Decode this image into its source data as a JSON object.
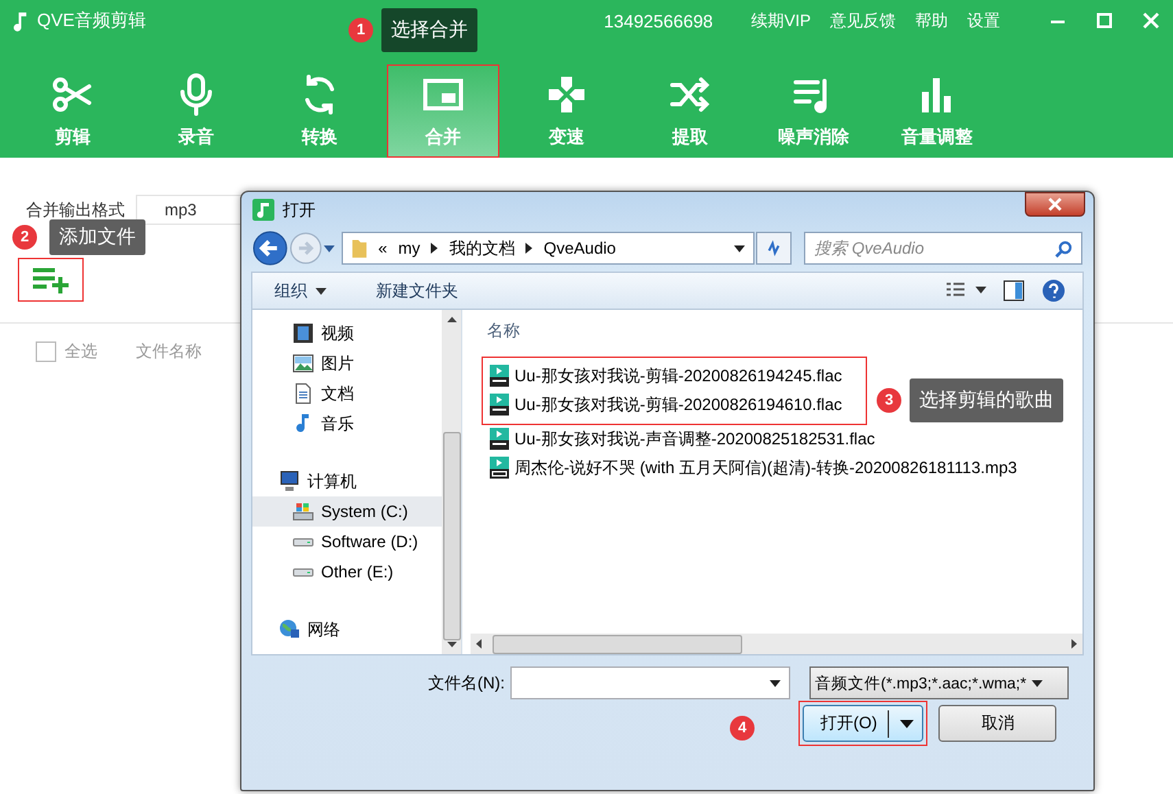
{
  "app": {
    "title": "QVE音频剪辑",
    "phone": "13492566698",
    "links": [
      "续期VIP",
      "意见反馈",
      "帮助",
      "设置"
    ]
  },
  "tools": [
    {
      "label": "剪辑",
      "selected": false,
      "highlighted": false
    },
    {
      "label": "录音",
      "selected": false,
      "highlighted": false
    },
    {
      "label": "转换",
      "selected": false,
      "highlighted": false
    },
    {
      "label": "合并",
      "selected": true,
      "highlighted": true
    },
    {
      "label": "变速",
      "selected": false,
      "highlighted": false
    },
    {
      "label": "提取",
      "selected": false,
      "highlighted": false
    },
    {
      "label": "噪声消除",
      "selected": false,
      "highlighted": false
    },
    {
      "label": "音量调整",
      "selected": false,
      "highlighted": false
    }
  ],
  "merge": {
    "format_label": "合并输出格式",
    "format_value": "mp3",
    "add_highlighted": true,
    "select_all": {
      "label": "全选",
      "checked": false
    },
    "column_2": "文件名称"
  },
  "callouts": [
    {
      "number": "1",
      "text": "选择合并"
    },
    {
      "number": "2",
      "text": "添加文件"
    },
    {
      "number": "3",
      "text": "选择剪辑的歌曲"
    },
    {
      "number": "4"
    }
  ],
  "dialog": {
    "title": "打开",
    "path": [
      "«",
      "my",
      "我的文档",
      "QveAudio"
    ],
    "search_placeholder": "搜索 QveAudio",
    "organize": "组织",
    "new_folder": "新建文件夹",
    "nav": [
      {
        "label": "视频",
        "kind": "video",
        "selected": false
      },
      {
        "label": "图片",
        "kind": "picture",
        "selected": false
      },
      {
        "label": "文档",
        "kind": "doc",
        "selected": false
      },
      {
        "label": "音乐",
        "kind": "music",
        "selected": false
      },
      {
        "label": "计算机",
        "kind": "computer",
        "selected": false,
        "children": [
          {
            "label": "System (C:)",
            "kind": "system",
            "selected": true
          },
          {
            "label": "Software (D:)",
            "kind": "drive",
            "selected": false
          },
          {
            "label": "Other (E:)",
            "kind": "drive",
            "selected": false
          }
        ]
      },
      {
        "label": "网络",
        "kind": "network",
        "selected": false
      }
    ],
    "column": "名称",
    "files": [
      {
        "name": "Uu-那女孩对我说-剪辑-20200826194245.flac",
        "kind": "flac",
        "highlighted": true
      },
      {
        "name": "Uu-那女孩对我说-剪辑-20200826194610.flac",
        "kind": "flac",
        "highlighted": true
      },
      {
        "name": "Uu-那女孩对我说-声音调整-20200825182531.flac",
        "kind": "flac",
        "highlighted": false
      },
      {
        "name": "周杰伦-说好不哭 (with 五月天阿信)(超清)-转换-20200826181113.mp3",
        "kind": "mp3",
        "highlighted": false
      }
    ],
    "filename_label": "文件名(N):",
    "filter": "音频文件(*.mp3;*.aac;*.wma;*",
    "open": "打开(O)",
    "open_highlighted": true,
    "cancel": "取消"
  }
}
